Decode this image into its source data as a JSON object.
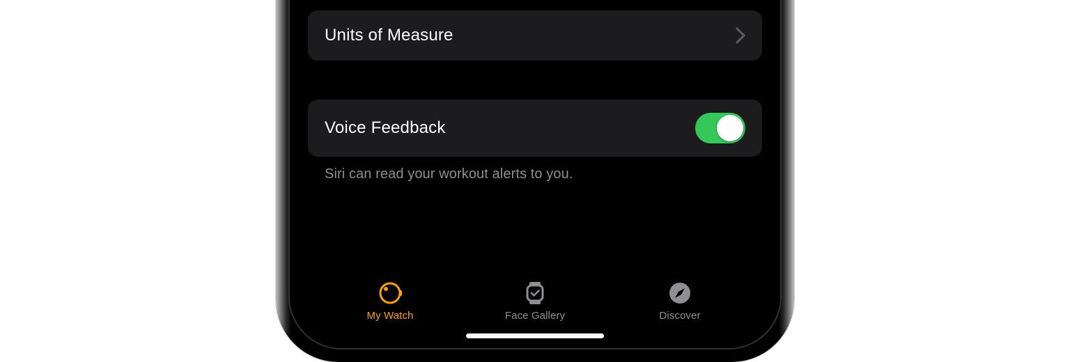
{
  "settings": {
    "units_row": {
      "label": "Units of Measure"
    },
    "voice_feedback_row": {
      "label": "Voice Feedback",
      "enabled": true
    },
    "voice_feedback_footer": "Siri can read your workout alerts to you."
  },
  "tab_bar": {
    "tabs": [
      {
        "label": "My Watch",
        "active": true
      },
      {
        "label": "Face Gallery",
        "active": false
      },
      {
        "label": "Discover",
        "active": false
      }
    ]
  },
  "colors": {
    "accent": "#ff9f0a",
    "toggle_on": "#34c759",
    "secondary_text": "#8e8e93",
    "row_bg": "#1c1c1e"
  }
}
